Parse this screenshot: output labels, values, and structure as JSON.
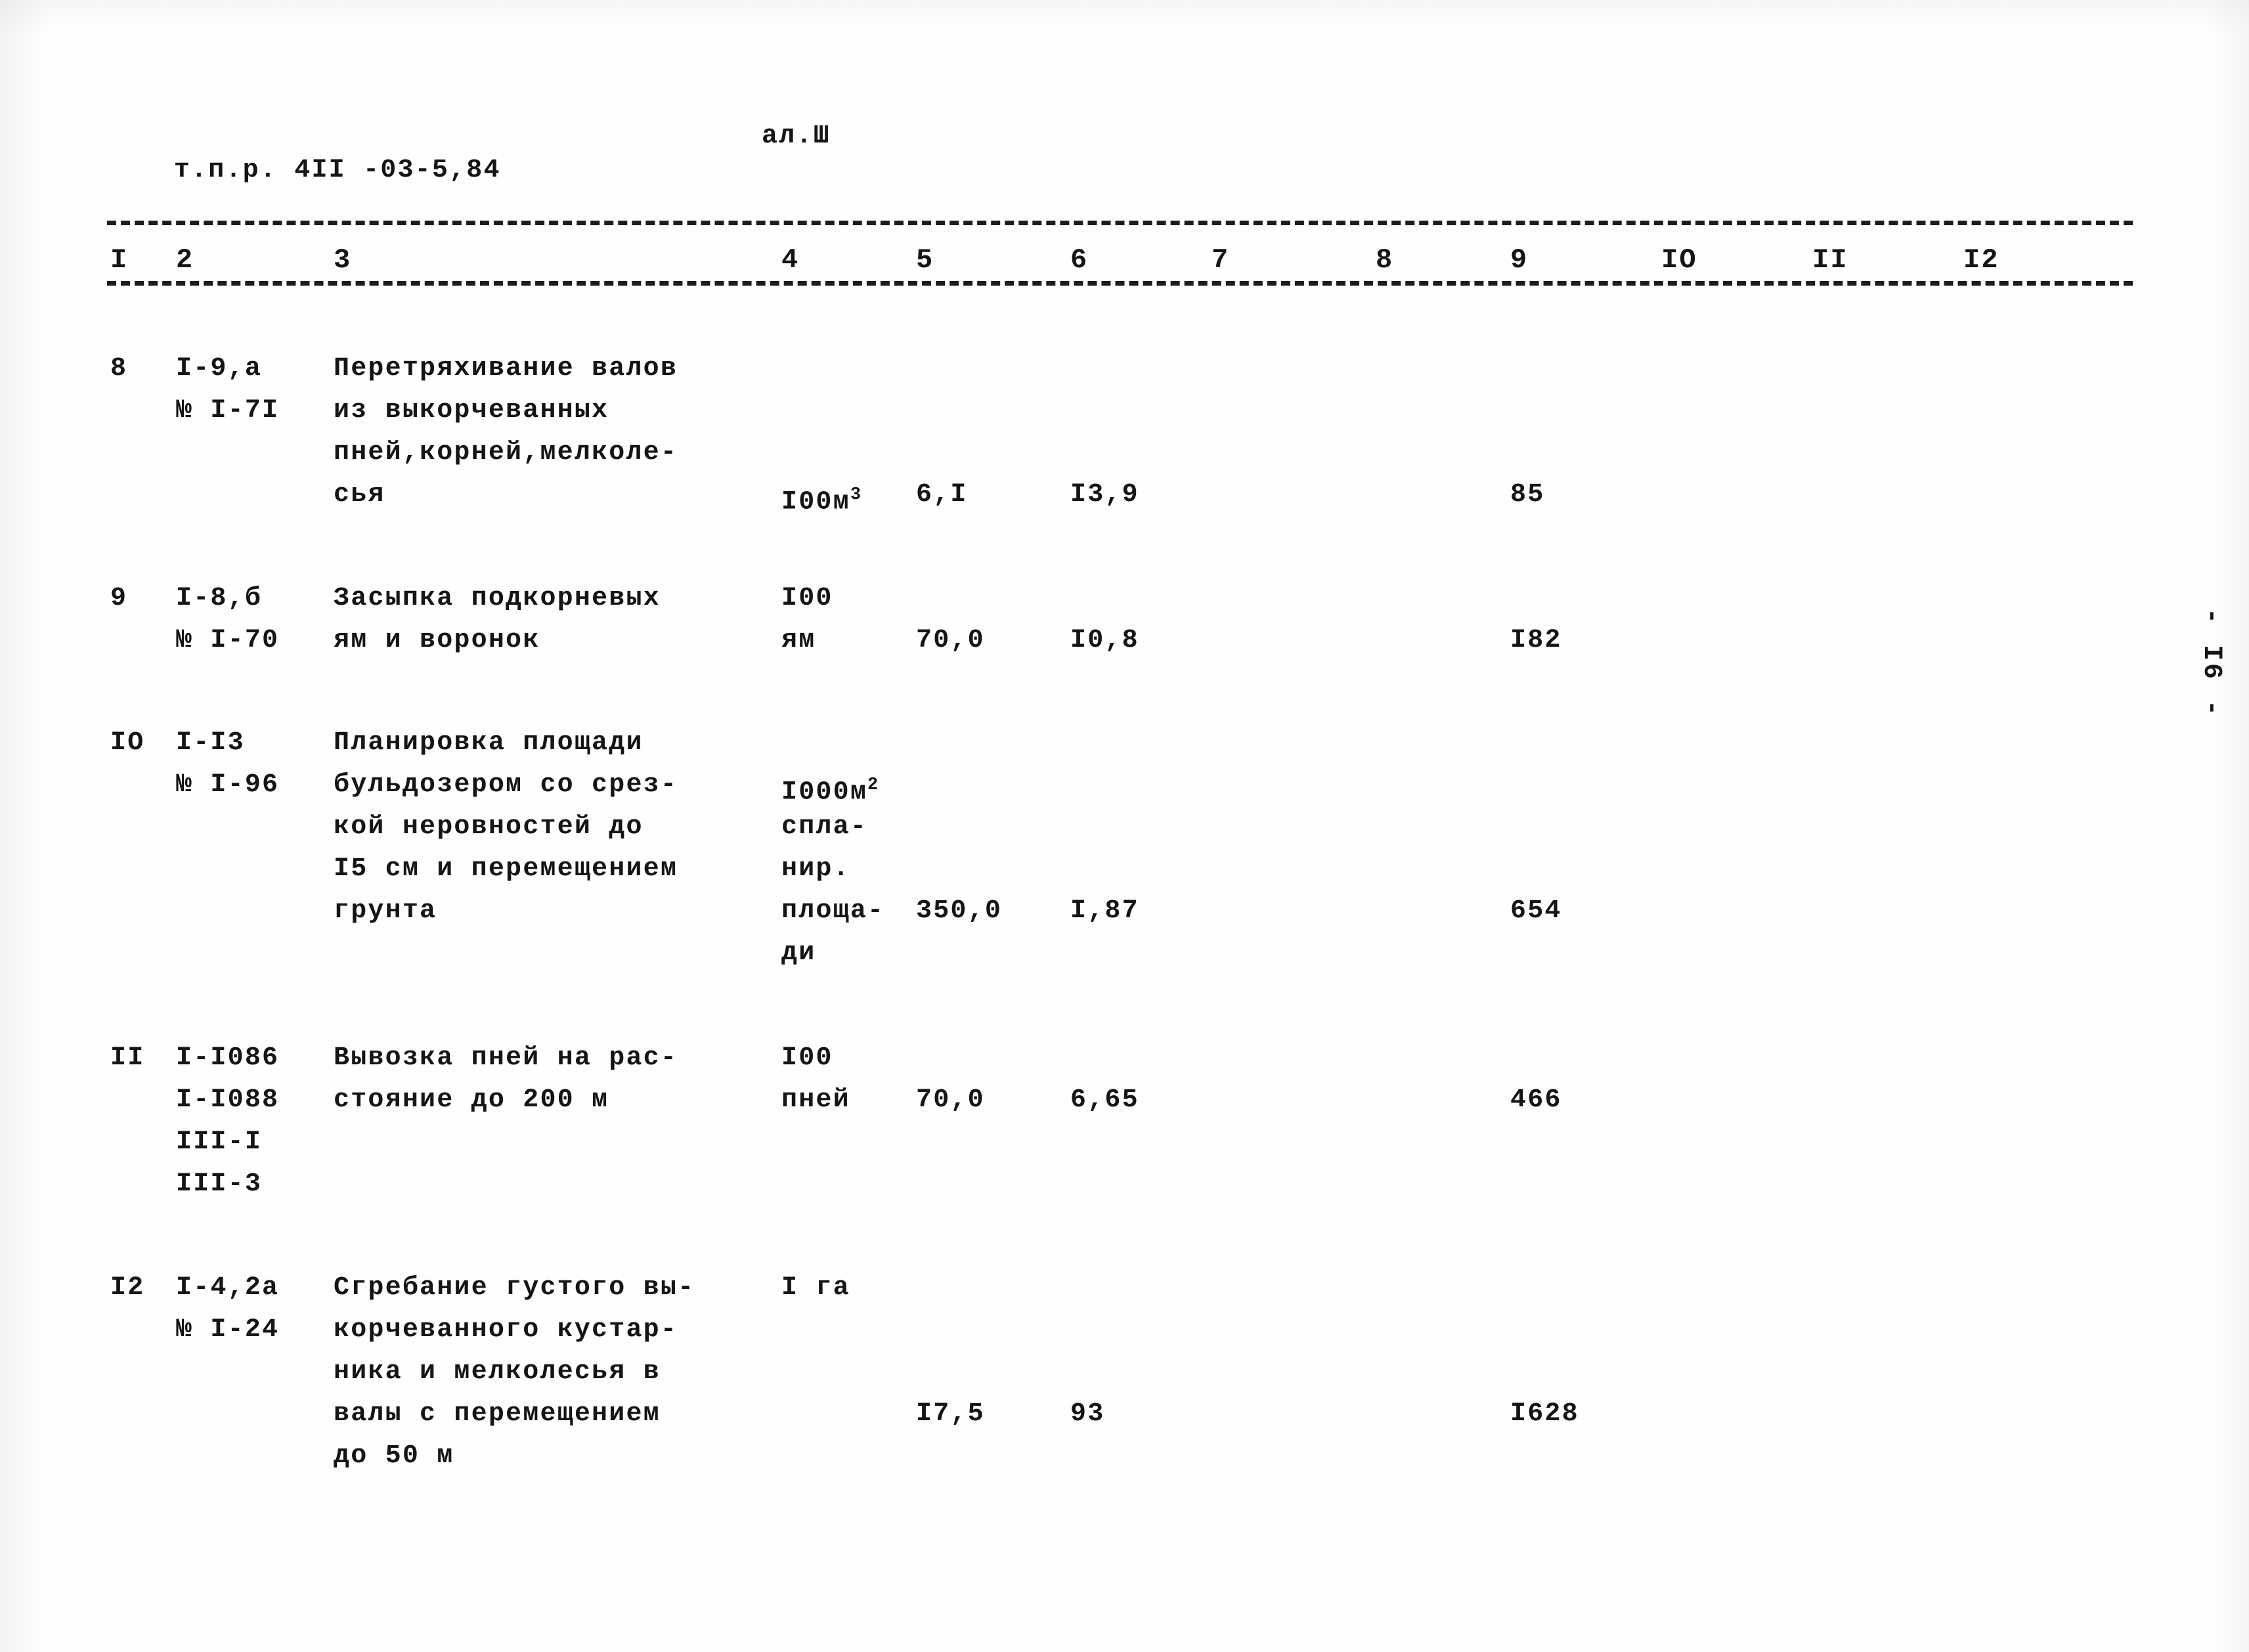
{
  "document": {
    "header_code": "т.п.р. 4II -03-5,84",
    "album_label": "ал.Ш",
    "page_marker": "- I6 -"
  },
  "table": {
    "column_numbers": [
      "I",
      "2",
      "3",
      "4",
      "5",
      "6",
      "7",
      "8",
      "9",
      "IO",
      "II",
      "I2"
    ],
    "rows": [
      {
        "no": "8",
        "code_lines": [
          "I-9,а",
          "№ I-7I"
        ],
        "description_lines": [
          "Перетряхивание валов",
          "из выкорчеванных",
          "пней,корней,мелколе-",
          "сья"
        ],
        "unit_lines": [
          "I00м"
        ],
        "unit_superscript": "3",
        "col5": "6,I",
        "col6": "I3,9",
        "col9": "85"
      },
      {
        "no": "9",
        "code_lines": [
          "I-8,б",
          "№ I-70"
        ],
        "description_lines": [
          "Засыпка подкорневых",
          "ям и воронок"
        ],
        "unit_lines": [
          "I00",
          "ям"
        ],
        "unit_superscript": "",
        "col5": "70,0",
        "col6": "I0,8",
        "col9": "I82"
      },
      {
        "no": "IO",
        "code_lines": [
          "I-I3",
          "№ I-96"
        ],
        "description_lines": [
          "Планировка площади",
          "бульдозером со срез-",
          "кой неровностей до",
          "I5 см и перемещением",
          "грунта"
        ],
        "unit_lines": [
          "I000м",
          "спла-",
          "нир.",
          "площа-",
          "ди"
        ],
        "unit_superscript": "2",
        "col5": "350,0",
        "col6": "I,87",
        "col9": "654"
      },
      {
        "no": "II",
        "code_lines": [
          "I-I086",
          "I-I088",
          "III-I",
          "III-3"
        ],
        "description_lines": [
          "Вывозка пней на рас-",
          "стояние до 200 м"
        ],
        "unit_lines": [
          "I00",
          "пней"
        ],
        "unit_superscript": "",
        "col5": "70,0",
        "col6": "6,65",
        "col9": "466"
      },
      {
        "no": "I2",
        "code_lines": [
          "I-4,2а",
          "№ I-24"
        ],
        "description_lines": [
          "Сгребание густого вы-",
          "корчеванного кустар-",
          "ника и мелколесья в",
          "валы с перемещением",
          "до 50 м"
        ],
        "unit_lines": [
          "I га"
        ],
        "unit_superscript": "",
        "col5": "I7,5",
        "col6": "93",
        "col9": "I628"
      }
    ]
  }
}
